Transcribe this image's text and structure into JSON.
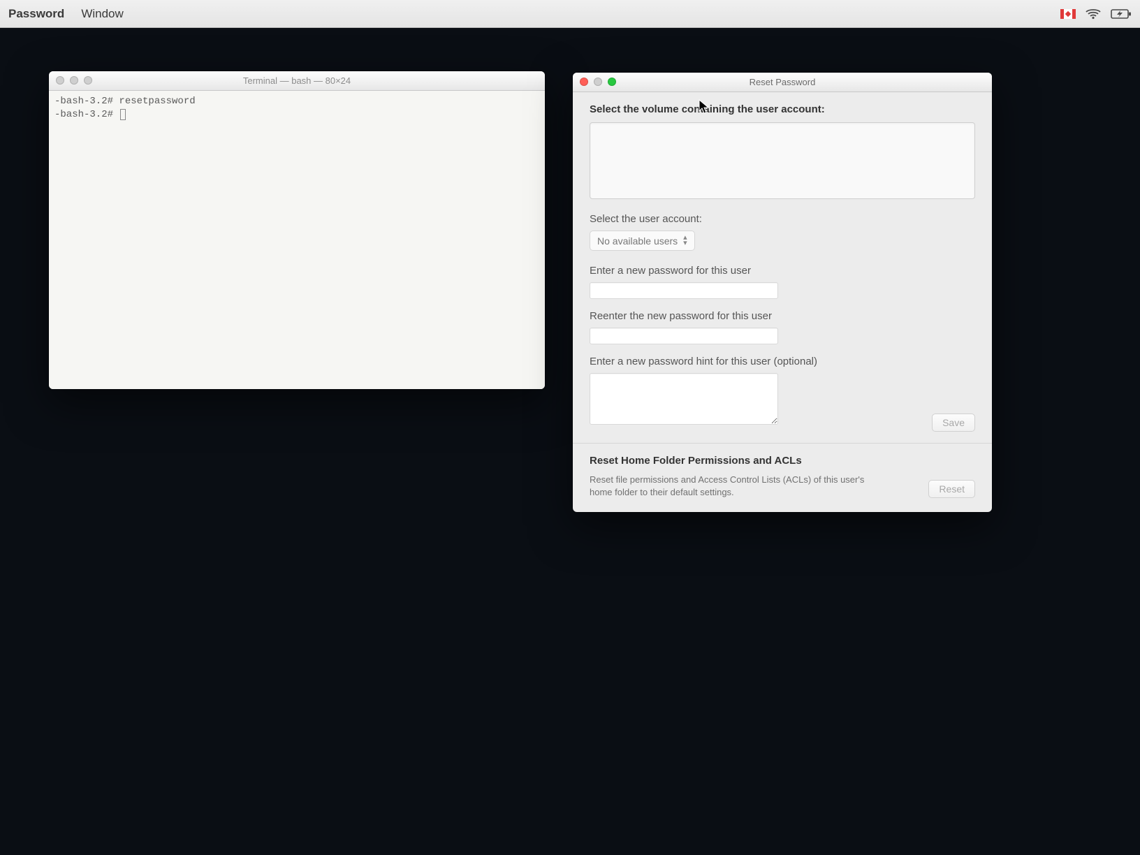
{
  "menubar": {
    "app_label": "Password",
    "window_menu": "Window"
  },
  "terminal": {
    "title": "Terminal — bash — 80×24",
    "line1": "-bash-3.2# resetpassword",
    "line2": "-bash-3.2# "
  },
  "reset": {
    "title": "Reset Password",
    "select_volume_label": "Select the volume containing the user account:",
    "select_user_label": "Select the user account:",
    "user_select_value": "No available users",
    "new_pw_label": "Enter a new password for this user",
    "reenter_pw_label": "Reenter the new password for this user",
    "hint_label": "Enter a new password hint for this user (optional)",
    "save_button": "Save",
    "perms_heading": "Reset Home Folder Permissions and ACLs",
    "perms_desc": "Reset file permissions and Access Control Lists (ACLs) of this user's home folder to their default settings.",
    "reset_button": "Reset"
  }
}
